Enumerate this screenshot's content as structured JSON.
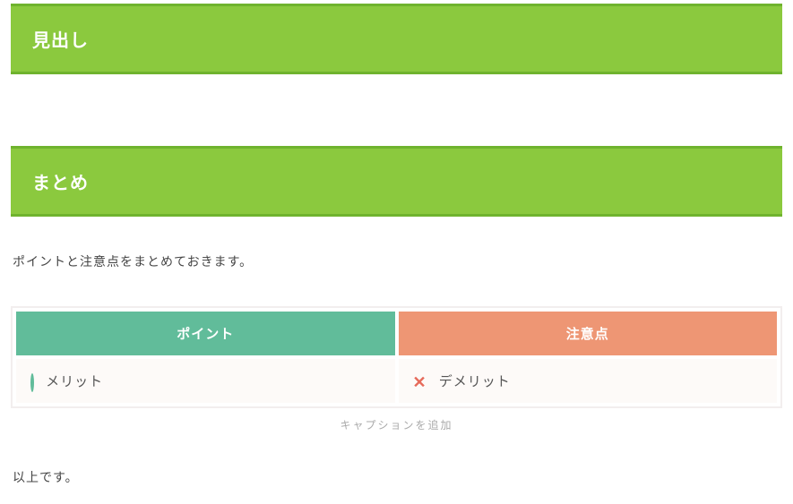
{
  "headings": {
    "first": "見出し",
    "second": "まとめ"
  },
  "intro_text": "ポイントと注意点をまとめておきます。",
  "table": {
    "header_pros": "ポイント",
    "header_cons": "注意点",
    "cell_pros": "メリット",
    "cell_cons": "デメリット"
  },
  "caption_placeholder": "キャプションを追加",
  "closing_text": "以上です。"
}
